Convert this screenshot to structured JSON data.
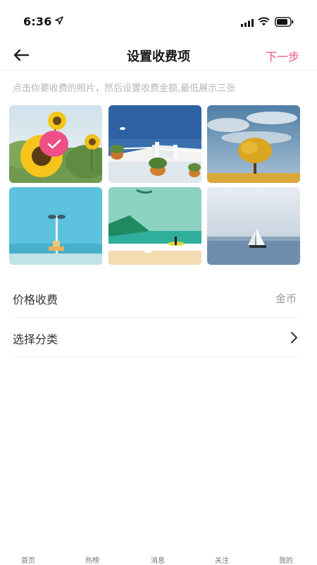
{
  "status_bar": {
    "time": "6:36"
  },
  "header": {
    "title": "设置收费项",
    "next_label": "下一步"
  },
  "hint": "点击你要收费的照片，然后设置收费金额,最低展示三张",
  "photos": [
    {
      "name": "sunflowers",
      "selected": true
    },
    {
      "name": "santorini-terrace",
      "selected": false
    },
    {
      "name": "golden-tree",
      "selected": false
    },
    {
      "name": "beach-lamp",
      "selected": false
    },
    {
      "name": "surf-beach",
      "selected": false
    },
    {
      "name": "sailboat",
      "selected": false
    }
  ],
  "settings": {
    "price_label": "价格收费",
    "price_value": "金币",
    "category_label": "选择分类"
  },
  "tabs": [
    "首页",
    "热榜",
    "消息",
    "关注",
    "我的"
  ],
  "colors": {
    "accent": "#ef4e87",
    "hint": "#b5b5b5"
  }
}
